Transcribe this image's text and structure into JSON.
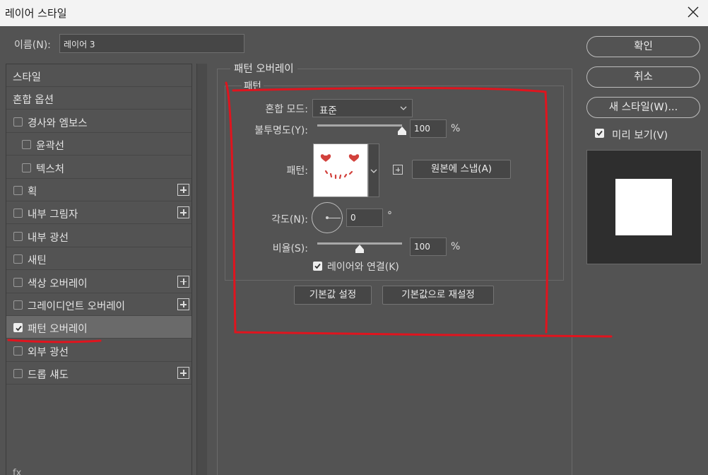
{
  "window": {
    "title": "레이어 스타일",
    "close_icon": "close-icon"
  },
  "name_field": {
    "label": "이름(N):",
    "value": "레이어 3"
  },
  "style_list": {
    "items": [
      {
        "label": "스타일",
        "checkbox": false,
        "checked": false,
        "plus": false,
        "indent": false,
        "selected": false
      },
      {
        "label": "혼합 옵션",
        "checkbox": false,
        "checked": false,
        "plus": false,
        "indent": false,
        "selected": false
      },
      {
        "label": "경사와 엠보스",
        "checkbox": true,
        "checked": false,
        "plus": false,
        "indent": false,
        "selected": false
      },
      {
        "label": "윤곽선",
        "checkbox": true,
        "checked": false,
        "plus": false,
        "indent": true,
        "selected": false
      },
      {
        "label": "텍스처",
        "checkbox": true,
        "checked": false,
        "plus": false,
        "indent": true,
        "selected": false
      },
      {
        "label": "획",
        "checkbox": true,
        "checked": false,
        "plus": true,
        "indent": false,
        "selected": false
      },
      {
        "label": "내부 그림자",
        "checkbox": true,
        "checked": false,
        "plus": true,
        "indent": false,
        "selected": false
      },
      {
        "label": "내부 광선",
        "checkbox": true,
        "checked": false,
        "plus": false,
        "indent": false,
        "selected": false
      },
      {
        "label": "새틴",
        "checkbox": true,
        "checked": false,
        "plus": false,
        "indent": false,
        "selected": false
      },
      {
        "label": "색상 오버레이",
        "checkbox": true,
        "checked": false,
        "plus": true,
        "indent": false,
        "selected": false
      },
      {
        "label": "그레이디언트 오버레이",
        "checkbox": true,
        "checked": false,
        "plus": true,
        "indent": false,
        "selected": false
      },
      {
        "label": "패턴 오버레이",
        "checkbox": true,
        "checked": true,
        "plus": false,
        "indent": false,
        "selected": true
      },
      {
        "label": "외부 광선",
        "checkbox": true,
        "checked": false,
        "plus": false,
        "indent": false,
        "selected": false
      },
      {
        "label": "드롭 섀도",
        "checkbox": true,
        "checked": false,
        "plus": true,
        "indent": false,
        "selected": false
      }
    ],
    "bottom_icons": "fx"
  },
  "panel": {
    "title": "패턴 오버레이",
    "section": "패턴",
    "blend_mode": {
      "label": "혼합 모드:",
      "value": "표준"
    },
    "opacity": {
      "label": "불투명도(Y):",
      "value": "100",
      "unit": "%",
      "level": 1.0
    },
    "pattern": {
      "label": "패턴:"
    },
    "snap_button": "원본에 스냅(A)",
    "angle": {
      "label": "각도(N):",
      "value": "0",
      "unit": "°"
    },
    "scale": {
      "label": "비율(S):",
      "value": "100",
      "unit": "%",
      "level": 0.5
    },
    "link_layer": {
      "label": "레이어와 연결(K)",
      "checked": true
    },
    "make_default": "기본값 설정",
    "reset_default": "기본값으로 재설정"
  },
  "right": {
    "ok": "확인",
    "cancel": "취소",
    "new_style": "새 스타일(W)...",
    "preview": {
      "label": "미리 보기(V)",
      "checked": true
    }
  },
  "colors": {
    "annotation_red": "#e0141e",
    "heart_red": "#d2413c"
  }
}
